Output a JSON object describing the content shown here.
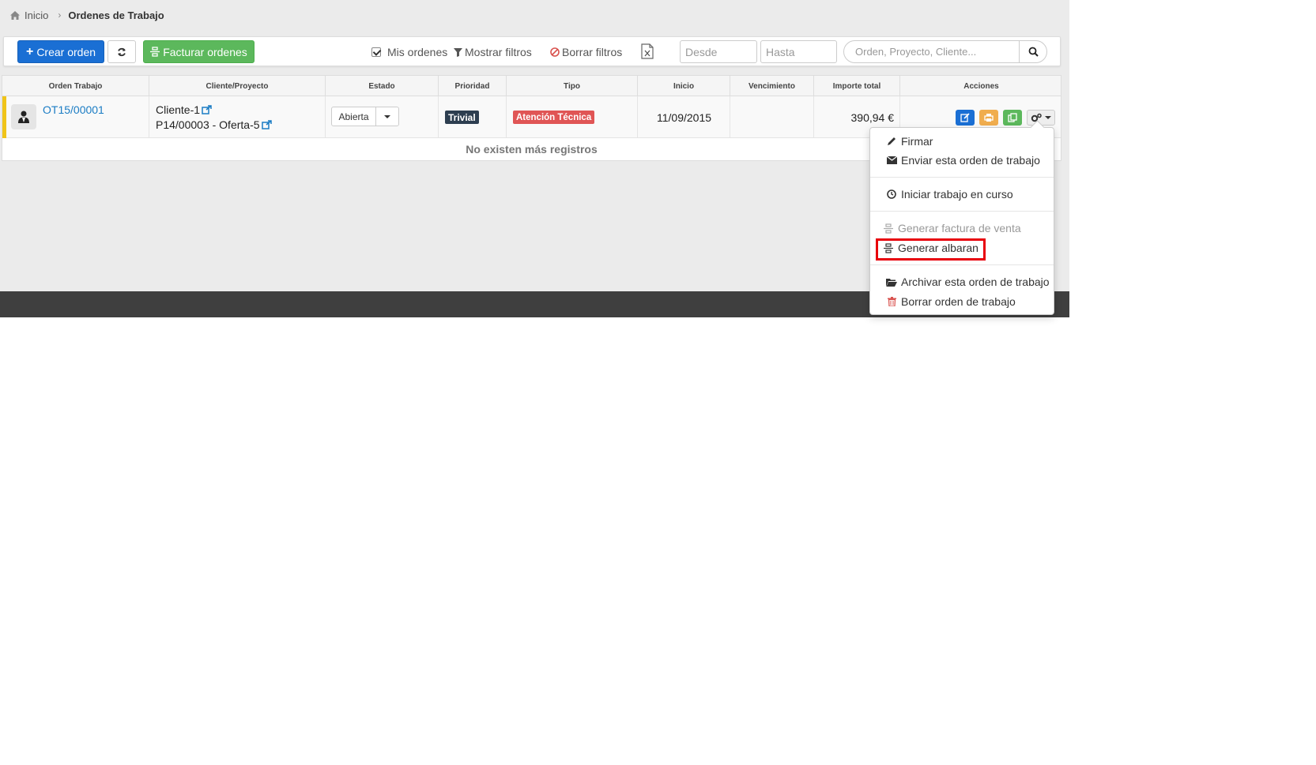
{
  "breadcrumb": {
    "home": "Inicio",
    "current": "Ordenes de Trabajo"
  },
  "toolbar": {
    "create_label": "Crear orden",
    "invoice_label": "Facturar ordenes",
    "my_orders_label": "Mis ordenes",
    "my_orders_checked": true,
    "show_filters_label": "Mostrar filtros",
    "clear_filters_label": "Borrar filtros",
    "from_placeholder": "Desde",
    "to_placeholder": "Hasta",
    "search_placeholder": "Orden, Proyecto, Cliente..."
  },
  "table": {
    "headers": [
      "Orden Trabajo",
      "Cliente/Proyecto",
      "Estado",
      "Prioridad",
      "Tipo",
      "Inicio",
      "Vencimiento",
      "Importe total",
      "Acciones"
    ],
    "rows": [
      {
        "order": "OT15/00001",
        "client": "Cliente-1",
        "project": "P14/00003 - Oferta-5",
        "status": "Abierta",
        "priority": "Trivial",
        "type": "Atención Técnica",
        "start": "11/09/2015",
        "due": "",
        "total": "390,94 €"
      }
    ],
    "empty_message": "No existen más registros"
  },
  "actions_menu": {
    "items": [
      {
        "label": "Firmar",
        "icon": "pencil-icon"
      },
      {
        "label": "Enviar esta orden de trabajo",
        "icon": "envelope-icon"
      },
      {
        "label": "Iniciar trabajo en curso",
        "icon": "clock-icon"
      },
      {
        "label": "Generar factura de venta",
        "icon": "convert-icon",
        "disabled": true
      },
      {
        "label": "Generar albaran",
        "icon": "convert-icon",
        "highlighted": true
      },
      {
        "label": "Archivar esta orden de trabajo",
        "icon": "folder-open-icon"
      },
      {
        "label": "Borrar orden de trabajo",
        "icon": "trash-icon"
      }
    ]
  },
  "colors": {
    "primary": "#1a6fd4",
    "success": "#5cb85c",
    "priority_badge": "#2d3e50",
    "type_badge": "#e05555",
    "highlight": "#e8000b",
    "row_flag": "#f0c419"
  }
}
